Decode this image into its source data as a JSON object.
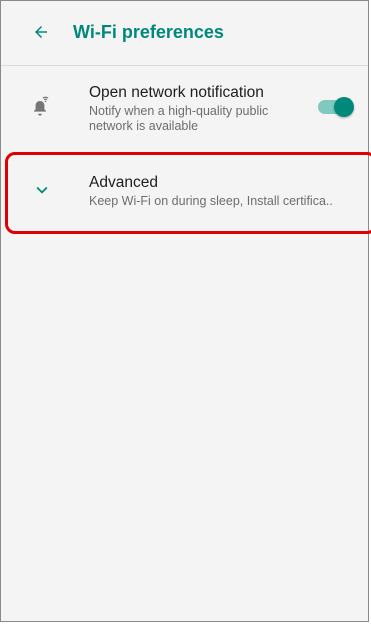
{
  "header": {
    "title": "Wi-Fi preferences",
    "back_icon": "arrow-back-icon"
  },
  "settings": [
    {
      "title": "Open network notification",
      "summary": "Notify when a high-quality public network is available",
      "icon": "notification-bell-wifi-icon",
      "toggle_on": true
    },
    {
      "title": "Advanced",
      "summary": "Keep Wi-Fi on during sleep, Install certifica..",
      "icon": "chevron-down-icon"
    }
  ],
  "colors": {
    "accent": "#00897b",
    "toggle_track": "#7fc9c1",
    "highlight": "#e00000"
  }
}
